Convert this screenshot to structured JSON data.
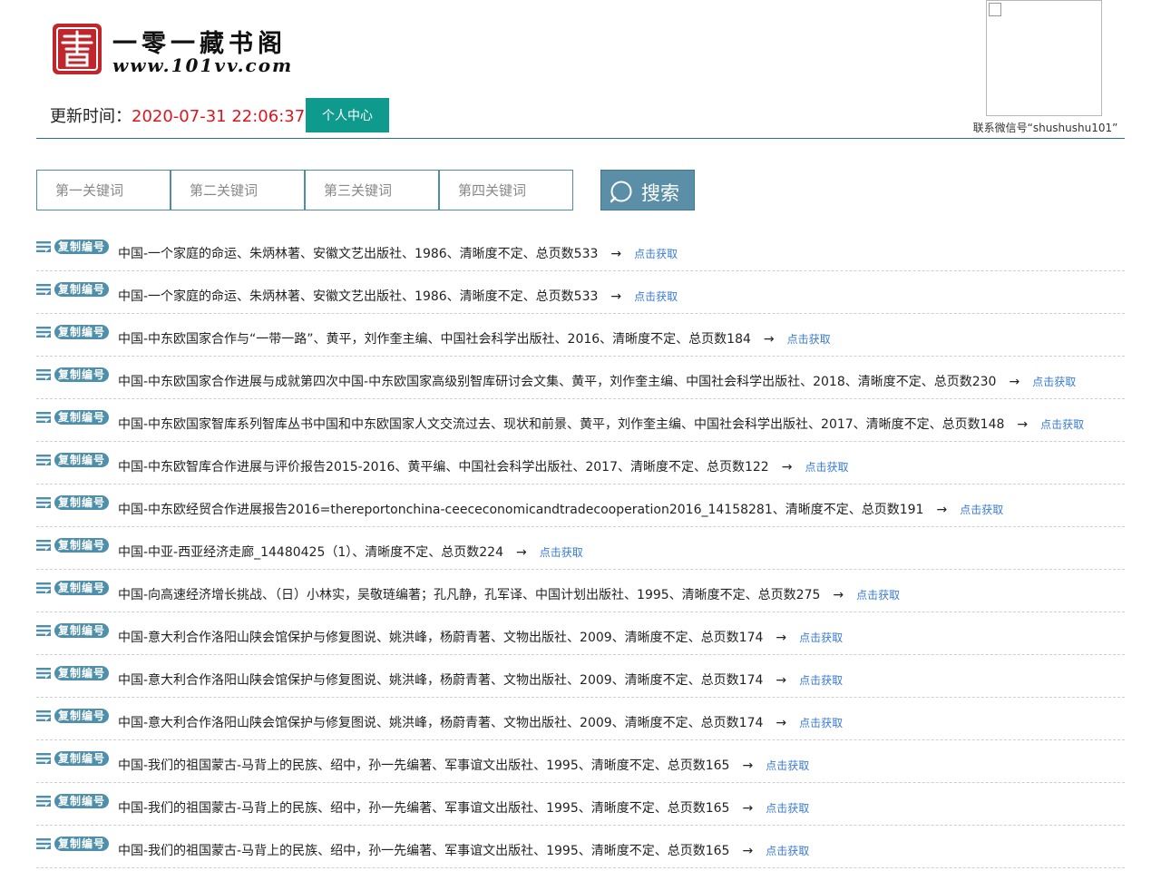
{
  "header": {
    "logo": {
      "title": "一零一藏书阁",
      "url": "www.101vv.com",
      "seal_char": "書",
      "seal_color": "#c0272d"
    },
    "update_label": "更新时间：",
    "update_time": "2020-07-31 22:06:37",
    "user_center_label": "个人中心",
    "qr_caption": "联系微信号“shushushu101”"
  },
  "search": {
    "fields": [
      {
        "placeholder": "第一关键词",
        "value": ""
      },
      {
        "placeholder": "第二关键词",
        "value": ""
      },
      {
        "placeholder": "第三关键词",
        "value": ""
      },
      {
        "placeholder": "第四关键词",
        "value": ""
      }
    ],
    "button_label": "搜索"
  },
  "list": {
    "copy_label": "复制编号",
    "arrow": "→",
    "link_label": "点击获取",
    "items": [
      {
        "text": "中国-一个家庭的命运、朱炳林著、安徽文艺出版社、1986、清晰度不定、总页数533"
      },
      {
        "text": "中国-一个家庭的命运、朱炳林著、安徽文艺出版社、1986、清晰度不定、总页数533"
      },
      {
        "text": "中国-中东欧国家合作与“一带一路”、黄平，刘作奎主编、中国社会科学出版社、2016、清晰度不定、总页数184"
      },
      {
        "text": "中国-中东欧国家合作进展与成就第四次中国-中东欧国家高级别智库研讨会文集、黄平，刘作奎主编、中国社会科学出版社、2018、清晰度不定、总页数230"
      },
      {
        "text": "中国-中东欧国家智库系列智库丛书中国和中东欧国家人文交流过去、现状和前景、黄平，刘作奎主编、中国社会科学出版社、2017、清晰度不定、总页数148"
      },
      {
        "text": "中国-中东欧智库合作进展与评价报告2015-2016、黄平编、中国社会科学出版社、2017、清晰度不定、总页数122"
      },
      {
        "text": "中国-中东欧经贸合作进展报告2016=thereportonchina-ceececonomicandtradecooperation2016_14158281、清晰度不定、总页数191"
      },
      {
        "text": "中国-中亚-西亚经济走廊_14480425（1）、清晰度不定、总页数224"
      },
      {
        "text": "中国-向高速经济增长挑战、（日）小林实，吴敬琏编著；孔凡静，孔军译、中国计划出版社、1995、清晰度不定、总页数275"
      },
      {
        "text": "中国-意大利合作洛阳山陕会馆保护与修复图说、姚洪峰，杨蔚青著、文物出版社、2009、清晰度不定、总页数174"
      },
      {
        "text": "中国-意大利合作洛阳山陕会馆保护与修复图说、姚洪峰，杨蔚青著、文物出版社、2009、清晰度不定、总页数174"
      },
      {
        "text": "中国-意大利合作洛阳山陕会馆保护与修复图说、姚洪峰，杨蔚青著、文物出版社、2009、清晰度不定、总页数174"
      },
      {
        "text": "中国-我们的祖国蒙古-马背上的民族、绍中，孙一先编著、军事谊文出版社、1995、清晰度不定、总页数165"
      },
      {
        "text": "中国-我们的祖国蒙古-马背上的民族、绍中，孙一先编著、军事谊文出版社、1995、清晰度不定、总页数165"
      },
      {
        "text": "中国-我们的祖国蒙古-马背上的民族、绍中，孙一先编著、军事谊文出版社、1995、清晰度不定、总页数165"
      }
    ]
  },
  "colors": {
    "accent": "#4e90ab",
    "button_teal": "#0e9a8c",
    "time_red": "#e0141e",
    "link_blue": "#3a7bd5"
  }
}
